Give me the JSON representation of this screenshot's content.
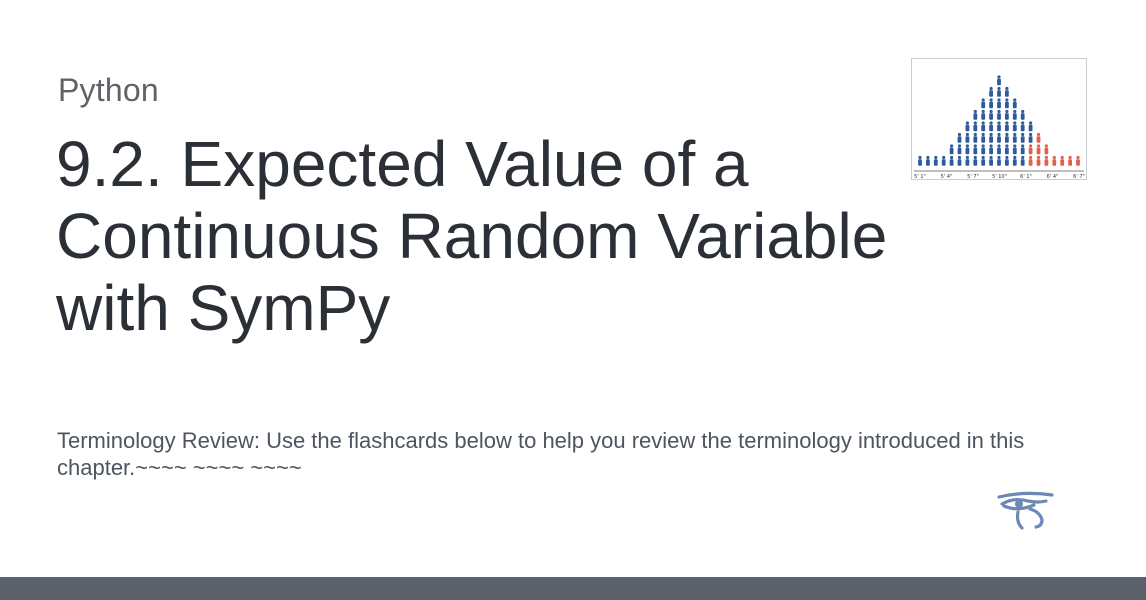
{
  "card": {
    "category": "Python",
    "title": "9.2. Expected Value of a Continuous Random Variable with SymPy",
    "description": "Terminology Review: Use the flashcards below to help you review the terminology introduced in this chapter.~~~~ ~~~~ ~~~~"
  },
  "thumbnail": {
    "axis_ticks": [
      "5' 1\"",
      "5' 4\"",
      "5' 7\"",
      "5' 10\"",
      "6' 1\"",
      "6' 4\"",
      "6' 7\""
    ],
    "colors": {
      "people_blue": "#2f5b9a",
      "people_red": "#e0614e"
    },
    "icon": "height-distribution-people-pictogram"
  },
  "logo": {
    "icon": "eye-of-horus-icon",
    "color": "#6e88b5"
  },
  "colors": {
    "title": "#2b2f36",
    "category": "#5f6368",
    "description": "#4d5560",
    "bottom_bar": "#5b616b"
  }
}
